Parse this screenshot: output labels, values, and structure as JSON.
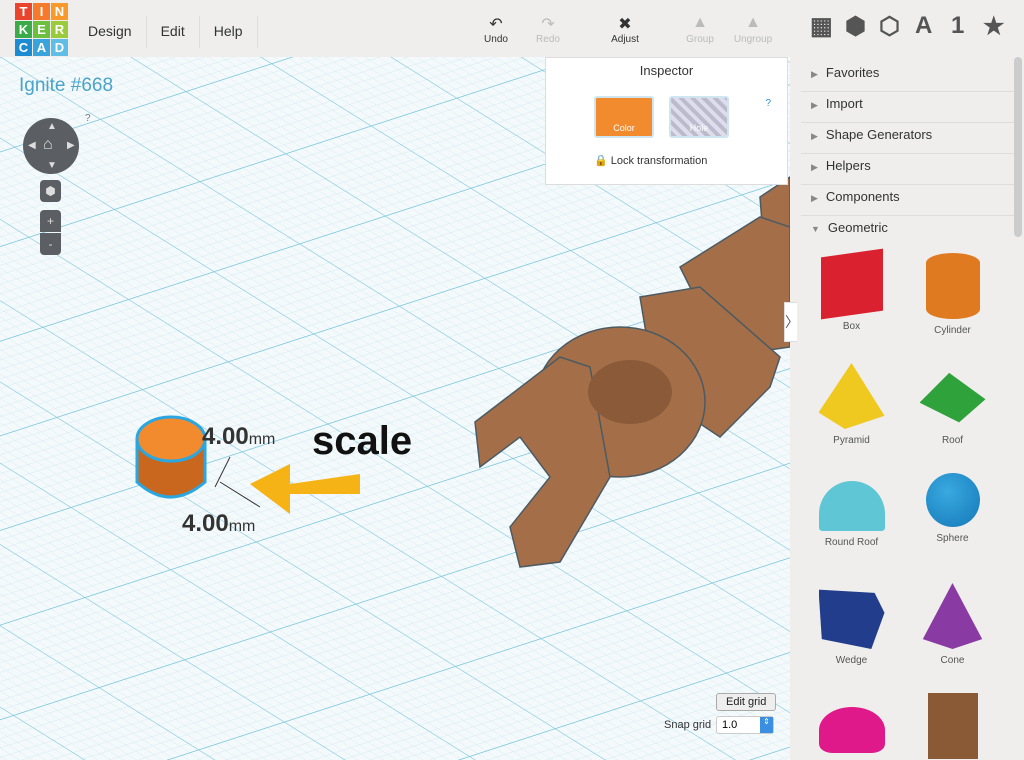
{
  "logo": [
    "T",
    "I",
    "N",
    "K",
    "E",
    "R",
    "C",
    "A",
    "D"
  ],
  "menu": [
    "Design",
    "Edit",
    "Help"
  ],
  "toolbar": {
    "undo": "Undo",
    "redo": "Redo",
    "adjust": "Adjust",
    "group": "Group",
    "ungroup": "Ungroup"
  },
  "view_icons": {
    "a": "A",
    "one": "1"
  },
  "project_title": "Ignite #668",
  "nav": {
    "help": "?",
    "zoom_in": "+",
    "zoom_out": "-"
  },
  "inspector": {
    "title": "Inspector",
    "color": "Color",
    "hole": "Hole",
    "help": "?",
    "lock": "Lock transformation",
    "color_hex": "#f28a2e"
  },
  "annotation": "scale",
  "dimensions": [
    {
      "value": "4.00",
      "unit": "mm"
    },
    {
      "value": "4.00",
      "unit": "mm"
    }
  ],
  "grid": {
    "edit": "Edit grid",
    "snap_label": "Snap grid",
    "snap_value": "1.0"
  },
  "sidebar": {
    "categories": [
      "Favorites",
      "Import",
      "Shape Generators",
      "Helpers",
      "Components",
      "Geometric"
    ],
    "shapes": [
      "Box",
      "Cylinder",
      "Pyramid",
      "Roof",
      "Round Roof",
      "Sphere",
      "Wedge",
      "Cone",
      "",
      ""
    ]
  }
}
